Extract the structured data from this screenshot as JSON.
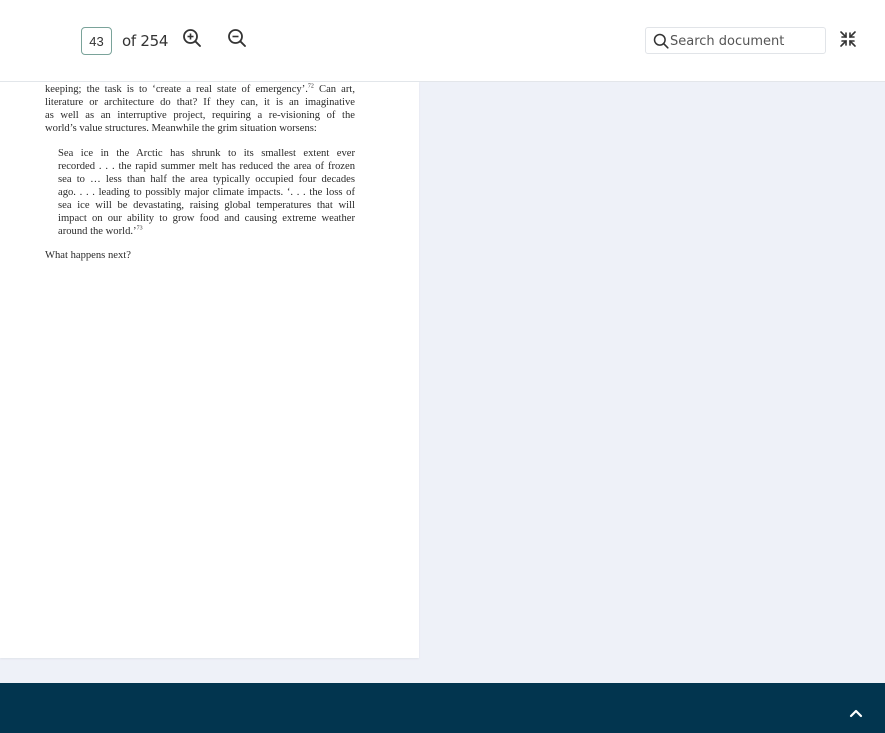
{
  "toolbar": {
    "page_current": "43",
    "page_of": "of 254",
    "zoom_in_icon": "zoom-in-icon",
    "zoom_out_icon": "zoom-out-icon",
    "search_placeholder": "Search document",
    "collapse_icon": "collapse-icon"
  },
  "document": {
    "para1_lines": [
      "keeping; the task is to ‘create a real state of emergency’.",
      "literature or architecture do that? If they can, it is an imaginative",
      "as well as an interruptive project, requiring a re-visioning of the",
      "world’s value structures. Meanwhile the grim situation worsens:"
    ],
    "para1_note": "72",
    "para1_after_note": " Can art,",
    "quote_lines": [
      "Sea ice in the Arctic has shrunk to its smallest extent ever",
      "recorded . . . the rapid summer melt has reduced the area of frozen",
      "sea to … less than half the area typically occupied four decades",
      "ago. . . . leading to possibly major climate impacts. ‘. . . the loss of",
      "sea ice will be devastating, raising global temperatures that will",
      "impact on our ability to grow food and causing extreme weather",
      "around the world.’"
    ],
    "quote_note": "73",
    "para3": "What happens next?"
  },
  "colors": {
    "footer": "#02354f",
    "background": "#eef1f8",
    "page_input_border": "#7aa39a"
  },
  "footer": {
    "scroll_up_icon": "chevron-up-icon"
  }
}
